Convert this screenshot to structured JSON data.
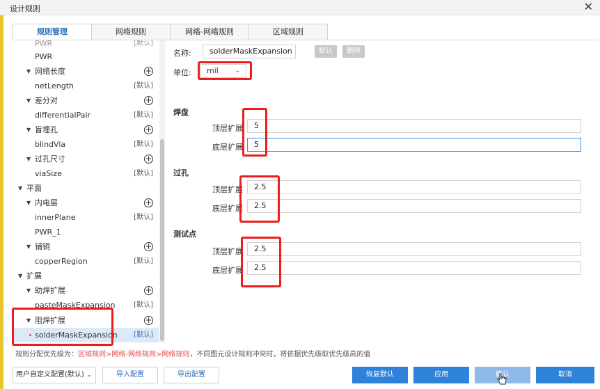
{
  "window": {
    "title": "设计规则",
    "close_glyph": "✕"
  },
  "tabs": [
    {
      "label": "规则管理",
      "active": true
    },
    {
      "label": "网络规则",
      "active": false
    },
    {
      "label": "网络-网络规则",
      "active": false
    },
    {
      "label": "区域规则",
      "active": false
    }
  ],
  "tree": {
    "partial_top": {
      "label": "PWR",
      "tag": "[默认]"
    },
    "items": [
      {
        "label": "PWR"
      },
      {
        "label": "网络长度"
      },
      {
        "label": "netLength",
        "tag": "[默认]"
      },
      {
        "label": "差分对"
      },
      {
        "label": "differentialPair",
        "tag": "[默认]"
      },
      {
        "label": "盲埋孔"
      },
      {
        "label": "blindVia",
        "tag": "[默认]"
      },
      {
        "label": "过孔尺寸"
      },
      {
        "label": "viaSize",
        "tag": "[默认]"
      },
      {
        "label": "平面"
      },
      {
        "label": "内电层"
      },
      {
        "label": "innerPlane",
        "tag": "[默认]"
      },
      {
        "label": "PWR_1"
      },
      {
        "label": "铺铜"
      },
      {
        "label": "copperRegion",
        "tag": "[默认]"
      },
      {
        "label": "扩展"
      },
      {
        "label": "助焊扩展"
      },
      {
        "label": "pasteMaskExpansion",
        "tag": "[默认]"
      },
      {
        "label": "阻焊扩展"
      },
      {
        "label": "solderMaskExpansion",
        "tag": "[默认]"
      }
    ]
  },
  "form": {
    "name_label": "名称:",
    "name_value": "solderMaskExpansion",
    "default_btn": "默认",
    "delete_btn": "删除",
    "unit_label": "单位:",
    "unit_value": "mil",
    "pad_section": "焊盘",
    "via_section": "过孔",
    "test_section": "测试点",
    "top_label": "顶层扩展",
    "bottom_label": "底层扩展",
    "pad_top": "5",
    "pad_bottom": "5",
    "via_top": "2.5",
    "via_bottom": "2.5",
    "test_top": "2.5",
    "test_bottom": "2.5"
  },
  "priority": {
    "prefix": "规则分配优先级为：",
    "order": "区域规则>网络-网络规则>网络规则",
    "suffix": "，不同图元设计规则冲突时，将依据优先级取优先级高的值"
  },
  "footer": {
    "config_select": "用户自定义配置(默认)",
    "import_btn": "导入配置",
    "export_btn": "导出配置",
    "restore_btn": "恢复默认",
    "apply_btn": "应用",
    "confirm_btn": "确认",
    "cancel_btn": "取消"
  },
  "colors": {
    "accent": "#2f82d9",
    "highlight_box": "#ee1c1c",
    "priority_text": "#e24b4b"
  }
}
